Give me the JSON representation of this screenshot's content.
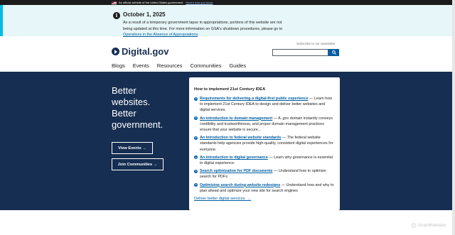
{
  "gov_banner": {
    "text": "An official website of the United States government",
    "link": "Here's how you know"
  },
  "alert": {
    "title": "October 1, 2025",
    "body_prefix": "As a result of a temporary government lapse in appropriations, portions of this website are not being updated at this time. For more information on GSA's shutdown procedures, please go to ",
    "link": "Operations in the Absence of Appropriations",
    "body_suffix": "."
  },
  "header": {
    "logo": "Digital.gov",
    "subscribe": "Subscribe to our newsletter",
    "search_placeholder": ""
  },
  "nav": [
    "Blogs",
    "Events",
    "Resources",
    "Communities",
    "Guides"
  ],
  "hero": {
    "tagline": [
      "Better",
      "websites.",
      "Better",
      "government."
    ],
    "view_events": "View Events",
    "join_communities": "Join Communities"
  },
  "card": {
    "title": "How to implement 21st Century IDEA",
    "items": [
      {
        "link": "Requirements for delivering a digital-first public experience",
        "text": " — Learn how to implement 21st Century IDEA to design and deliver better websites and digital services."
      },
      {
        "link": "An introduction to domain management",
        "text": " — A .gov domain instantly conveys credibility and trustworthiness, and proper domain management practices ensure that your website is secure..."
      },
      {
        "link": "An introduction to federal website standards",
        "text": " — The federal website standards help agencies provide high-quality, consistent digital experiences for everyone."
      },
      {
        "link": "An introduction to digital governance",
        "text": " — Learn why governance is essential to digital experience."
      },
      {
        "link": "Search optimization for PDF documents",
        "text": " — Understand how to optimize search for PDFs"
      },
      {
        "link": "Optimizing search during website redesigns",
        "text": " — Understand how and why to plan ahead and optimize your new site for search engines"
      }
    ],
    "footer_link": "Deliver better digital services"
  },
  "watermark": "ScanMalware",
  "colors": {
    "navy": "#162e51",
    "link": "#005ea2",
    "alert_bg": "#e7f6f8",
    "alert_border": "#00bde3",
    "banner_bg": "#1b1b1b"
  }
}
